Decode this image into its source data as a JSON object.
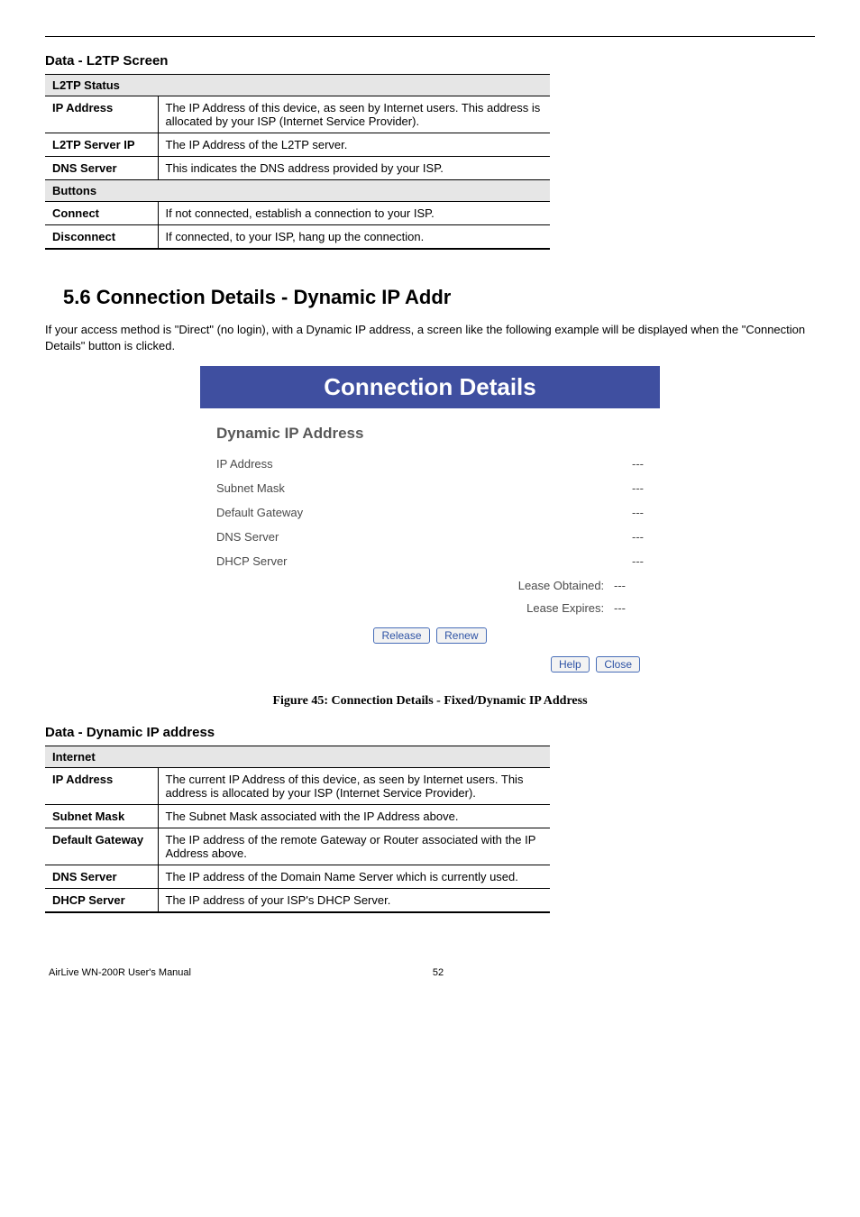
{
  "header_l2tp_title": "Data - L2TP Screen",
  "table1": {
    "section1": "L2TP Status",
    "rows1": [
      {
        "lbl": "IP Address",
        "txt": "The IP Address of this device, as seen by Internet users. This address is allocated by your ISP (Internet Service Provider)."
      },
      {
        "lbl": "L2TP Server IP",
        "txt": "The IP Address of the L2TP server."
      },
      {
        "lbl": "DNS Server",
        "txt": "This indicates the DNS address provided by your ISP."
      }
    ],
    "section2": "Buttons",
    "rows2": [
      {
        "lbl": "Connect",
        "txt": "If not connected, establish a connection to your ISP."
      },
      {
        "lbl": "Disconnect",
        "txt": "If connected, to your ISP, hang up the connection."
      }
    ]
  },
  "section_heading": "5.6  Connection Details - Dynamic IP Addr",
  "intro_para": "If your access method is \"Direct\" (no login), with a Dynamic IP address, a screen like the following example will be displayed when the \"Connection Details\" button is clicked.",
  "panel": {
    "title": "Connection Details",
    "subtitle": "Dynamic IP Address",
    "rows": [
      {
        "k": "IP Address",
        "v": "---"
      },
      {
        "k": "Subnet Mask",
        "v": "---"
      },
      {
        "k": "Default Gateway",
        "v": "---"
      },
      {
        "k": "DNS Server",
        "v": "---"
      },
      {
        "k": "DHCP Server",
        "v": "---"
      }
    ],
    "lease_obtained_lbl": "Lease Obtained:",
    "lease_obtained_val": "---",
    "lease_expires_lbl": "Lease Expires:",
    "lease_expires_val": "---",
    "btn_release": "Release",
    "btn_renew": "Renew",
    "btn_help": "Help",
    "btn_close": "Close"
  },
  "fig_caption": "Figure 45: Connection Details - Fixed/Dynamic IP Address",
  "header_dyn_title": "Data - Dynamic IP address",
  "table2": {
    "section1": "Internet",
    "rows": [
      {
        "lbl": "IP Address",
        "txt": "The current IP Address of this device, as seen by Internet users. This address is allocated by your ISP (Internet Service Provider)."
      },
      {
        "lbl": "Subnet Mask",
        "txt": "The Subnet Mask associated with the IP Address above."
      },
      {
        "lbl": "Default Gateway",
        "txt": "The IP address of the remote Gateway or Router associated with the IP Address above."
      },
      {
        "lbl": "DNS Server",
        "txt": "The IP address of the Domain Name Server which is currently used."
      },
      {
        "lbl": "DHCP Server",
        "txt": "The IP address of your ISP's DHCP Server."
      }
    ]
  },
  "footer_left": "AirLive WN-200R User's Manual",
  "footer_page": "52"
}
